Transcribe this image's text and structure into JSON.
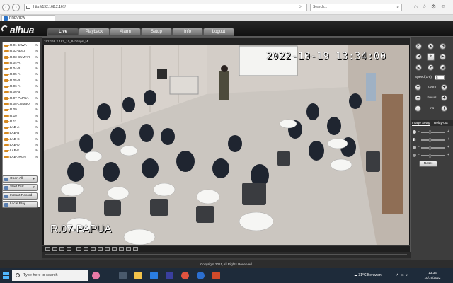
{
  "browser": {
    "url": "http://192.168.2.167/",
    "search_placeholder": "Search...",
    "tab_title": "PREVIEW"
  },
  "app": {
    "logo": "alhua",
    "nav_tabs": [
      "Live",
      "Playback",
      "Alarm",
      "Setup",
      "Info",
      "Logout"
    ],
    "active_tab": "Live"
  },
  "devices": [
    {
      "label": "R.01-JAWA",
      "flag": "M"
    },
    {
      "label": "R.02-BALI",
      "flag": "M"
    },
    {
      "label": "R.03-SUMATI",
      "flag": "M"
    },
    {
      "label": "R.04-A",
      "flag": "M"
    },
    {
      "label": "R.04-B",
      "flag": "M"
    },
    {
      "label": "R.05-A",
      "flag": "M"
    },
    {
      "label": "R.05-B",
      "flag": "M"
    },
    {
      "label": "R.06-A",
      "flag": "M"
    },
    {
      "label": "R.06-B",
      "flag": "M"
    },
    {
      "label": "R.07-PAPUA",
      "flag": "M"
    },
    {
      "label": "R.08-LOMBO",
      "flag": "M"
    },
    {
      "label": "R.09",
      "flag": "M"
    },
    {
      "label": "R.10",
      "flag": "M"
    },
    {
      "label": "R.11",
      "flag": "M"
    },
    {
      "label": "LAB-A",
      "flag": "M"
    },
    {
      "label": "LAB-B",
      "flag": "M"
    },
    {
      "label": "LAB-C",
      "flag": "M"
    },
    {
      "label": "LAB-D",
      "flag": "M"
    },
    {
      "label": "LAB-E",
      "flag": "M"
    },
    {
      "label": "LAB-JRGN",
      "flag": "M"
    }
  ],
  "side_buttons": {
    "open_all": "Open All",
    "start_talk": "Start Talk",
    "instant_record": "Instant Record",
    "local_play": "Local Play"
  },
  "video": {
    "stream_info": "192.168.2.167_10_8436bps_M",
    "timestamp": "2022-10-19 13:34:00",
    "camera_name": "R.07-PAPUA"
  },
  "ptz": {
    "speed_label": "Speed(1-8)",
    "speed_value": "5",
    "zoom_label": "Zoom",
    "focus_label": "Focus",
    "iris_label": "Iris"
  },
  "image_setup": {
    "tabs": [
      "Image Setup",
      "Relay-out"
    ],
    "sliders": [
      {
        "icon": "brightness-icon",
        "level": 0.35
      },
      {
        "icon": "contrast-icon",
        "level": 0.35
      },
      {
        "icon": "hue-icon",
        "level": 0.35
      },
      {
        "icon": "saturation-icon",
        "level": 0.35
      }
    ],
    "reset_label": "Reset"
  },
  "footer": {
    "copyright": "Copyright 2015,All Rights Reserved."
  },
  "taskbar": {
    "search_placeholder": "Type here to search",
    "weather": "31°C  Berawan",
    "time": "13:34",
    "date": "10/19/2022"
  }
}
